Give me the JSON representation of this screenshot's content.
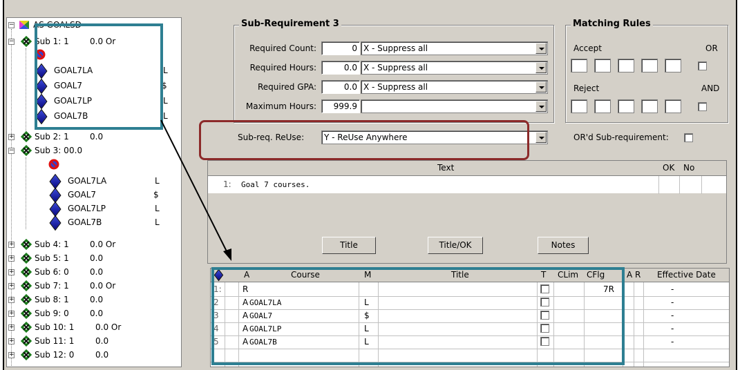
{
  "tree": {
    "root": "AS GOALSD",
    "nodes": [
      {
        "label": "Sub 1:  1",
        "val": "0.0  Or"
      },
      {
        "label": "Sub 2:  1",
        "val": "0.0"
      },
      {
        "label": "Sub 3:  0",
        "val": "0.0"
      },
      {
        "label": "Sub 4:  1",
        "val": "0.0  Or"
      },
      {
        "label": "Sub 5:  1",
        "val": "0.0"
      },
      {
        "label": "Sub 6:  0",
        "val": "0.0"
      },
      {
        "label": "Sub 7:  1",
        "val": "0.0  Or"
      },
      {
        "label": "Sub 8:  1",
        "val": "0.0"
      },
      {
        "label": "Sub 9:  0",
        "val": "0.0"
      },
      {
        "label": "Sub 10:  1",
        "val": "0.0  Or"
      },
      {
        "label": "Sub 11:  1",
        "val": "0.0"
      },
      {
        "label": "Sub 12:  0",
        "val": "0.0"
      }
    ],
    "sub1_courses": [
      {
        "name": "GOAL7LA",
        "flag": "L"
      },
      {
        "name": "GOAL7",
        "flag": "$"
      },
      {
        "name": "GOAL7LP",
        "flag": "L"
      },
      {
        "name": "GOAL7B",
        "flag": "L"
      }
    ],
    "sub3_courses": [
      {
        "name": "GOAL7LA",
        "flag": "L"
      },
      {
        "name": "GOAL7",
        "flag": "$"
      },
      {
        "name": "GOAL7LP",
        "flag": "L"
      },
      {
        "name": "GOAL7B",
        "flag": "L"
      }
    ]
  },
  "subreq": {
    "title": "Sub-Requirement 3",
    "req_count_label": "Required Count:",
    "req_count": "0",
    "req_count_opt": "X - Suppress all",
    "req_hours_label": "Required Hours:",
    "req_hours": "0.0",
    "req_hours_opt": "X - Suppress all",
    "req_gpa_label": "Required GPA:",
    "req_gpa": "0.0",
    "req_gpa_opt": "X - Suppress all",
    "max_hours_label": "Maximum Hours:",
    "max_hours": "999.9",
    "max_hours_opt": ""
  },
  "matching": {
    "title": "Matching Rules",
    "accept": "Accept",
    "or": "OR",
    "reject": "Reject",
    "and": "AND"
  },
  "reuse": {
    "label": "Sub-req. ReUse:",
    "value": "Y - ReUse Anywhere",
    "ord_label": "OR'd Sub-requirement:"
  },
  "text_grid": {
    "col_text": "Text",
    "col_ok": "OK",
    "col_no": "No",
    "row_num": "1:",
    "row_text": "Goal 7 courses."
  },
  "buttons": {
    "title": "Title",
    "title_ok": "Title/OK",
    "notes": "Notes"
  },
  "course_grid": {
    "headers": {
      "a": "A",
      "course": "Course",
      "m": "M",
      "title": "Title",
      "t": "T",
      "clim": "CLim",
      "cflg": "CFlg",
      "ar": "A  R",
      "eff": "Effective Date"
    },
    "rows": [
      {
        "n": "1:",
        "a": "R",
        "course": "",
        "m": "",
        "cflg": "7R",
        "eff": "-"
      },
      {
        "n": "2",
        "a": "A",
        "course": "GOAL7LA",
        "m": "L",
        "cflg": "",
        "eff": "-"
      },
      {
        "n": "3",
        "a": "A",
        "course": "GOAL7",
        "m": "$",
        "cflg": "",
        "eff": "-"
      },
      {
        "n": "4",
        "a": "A",
        "course": "GOAL7LP",
        "m": "L",
        "cflg": "",
        "eff": "-"
      },
      {
        "n": "5",
        "a": "A",
        "course": "GOAL7B",
        "m": "L",
        "cflg": "",
        "eff": "-"
      }
    ]
  },
  "colors": {
    "highlight_teal": "#2e7f92",
    "highlight_maroon": "#8c2a2a",
    "titlebar": "#0a246a"
  }
}
